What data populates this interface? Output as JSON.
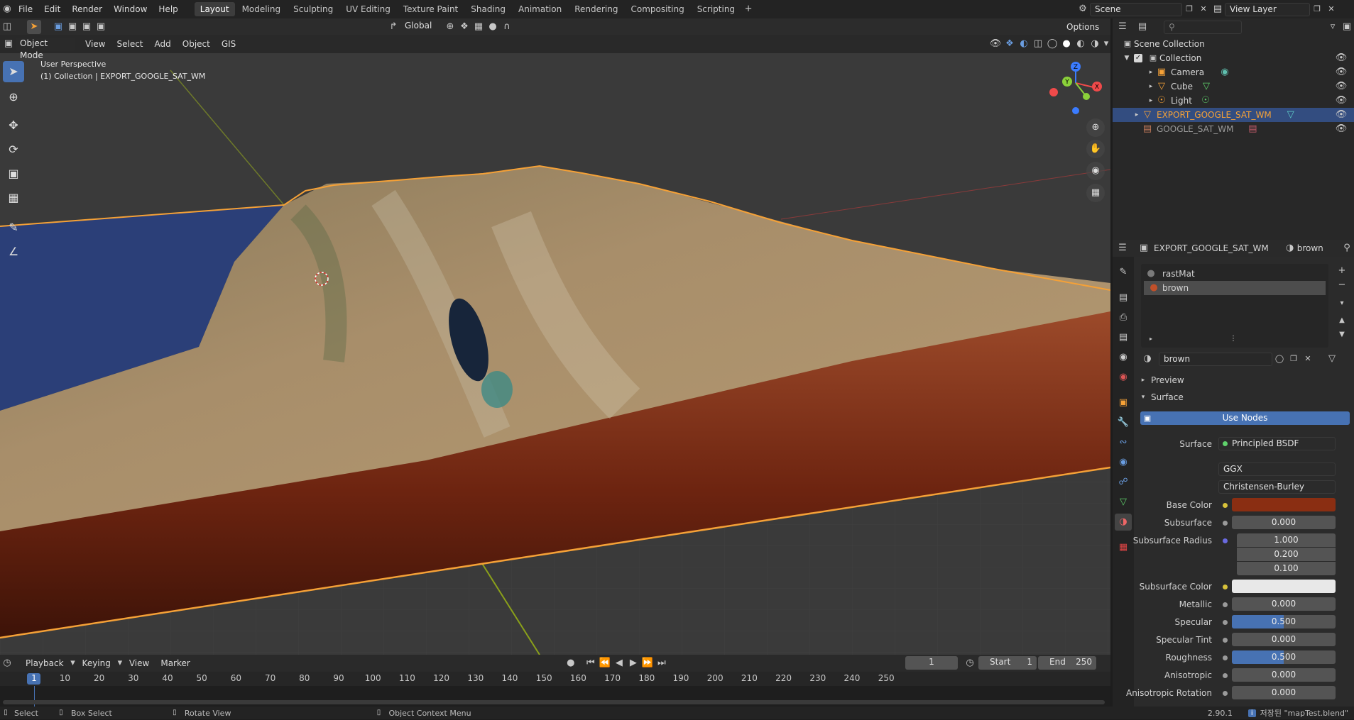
{
  "menus": [
    "File",
    "Edit",
    "Render",
    "Window",
    "Help"
  ],
  "workspaces": [
    "Layout",
    "Modeling",
    "Sculpting",
    "UV Editing",
    "Texture Paint",
    "Shading",
    "Animation",
    "Rendering",
    "Compositing",
    "Scripting"
  ],
  "scene": "Scene",
  "view_layer": "View Layer",
  "viewport": {
    "mode": "Object Mode",
    "menu": [
      "View",
      "Select",
      "Add",
      "Object",
      "GIS"
    ],
    "orientation": "Global",
    "options": "Options",
    "overlay_title": "User Perspective",
    "overlay_sub": "(1) Collection | EXPORT_GOOGLE_SAT_WM"
  },
  "outliner": {
    "items": [
      "Scene Collection",
      "Collection",
      "Camera",
      "Cube",
      "Light",
      "EXPORT_GOOGLE_SAT_WM",
      "GOOGLE_SAT_WM"
    ]
  },
  "properties": {
    "object": "EXPORT_GOOGLE_SAT_WM",
    "material": "brown",
    "slots": [
      "rastMat",
      "brown"
    ],
    "mat_name": "brown",
    "panels": [
      "Preview",
      "Surface"
    ],
    "use_nodes": "Use Nodes",
    "surface_label": "Surface",
    "surface_value": "Principled BSDF",
    "distribution": "GGX",
    "subsurface_method": "Christensen-Burley",
    "base_color_label": "Base Color",
    "base_color": "#8a2e12",
    "subsurface_label": "Subsurface",
    "subsurface": "0.000",
    "ss_radius_label": "Subsurface Radius",
    "ss_radius": [
      "1.000",
      "0.200",
      "0.100"
    ],
    "ss_color_label": "Subsurface Color",
    "ss_color": "#e8e8e8",
    "metallic_label": "Metallic",
    "metallic": "0.000",
    "specular_label": "Specular",
    "specular": "0.500",
    "specular_frac": 0.5,
    "spec_tint_label": "Specular Tint",
    "spec_tint": "0.000",
    "roughness_label": "Roughness",
    "roughness": "0.500",
    "roughness_frac": 0.5,
    "aniso_label": "Anisotropic",
    "aniso": "0.000",
    "aniso_rot_label": "Anisotropic Rotation",
    "aniso_rot": "0.000"
  },
  "timeline": {
    "menu": [
      "Playback",
      "Keying",
      "View",
      "Marker"
    ],
    "current": "1",
    "start_label": "Start",
    "start": "1",
    "end_label": "End",
    "end": "250",
    "ticks": [
      "1",
      "10",
      "20",
      "30",
      "40",
      "50",
      "60",
      "70",
      "80",
      "90",
      "100",
      "110",
      "120",
      "130",
      "140",
      "150",
      "160",
      "170",
      "180",
      "190",
      "200",
      "210",
      "220",
      "230",
      "240",
      "250"
    ]
  },
  "status": {
    "select": "Select",
    "box_select": "Box Select",
    "rotate": "Rotate View",
    "context": "Object Context Menu",
    "version": "2.90.1",
    "file": "저장된 \"mapTest.blend\""
  },
  "colors": {
    "accent": "#4772b3",
    "selection": "#f5a137",
    "sea": "#2b3f78",
    "wall": "#7a2a12"
  }
}
